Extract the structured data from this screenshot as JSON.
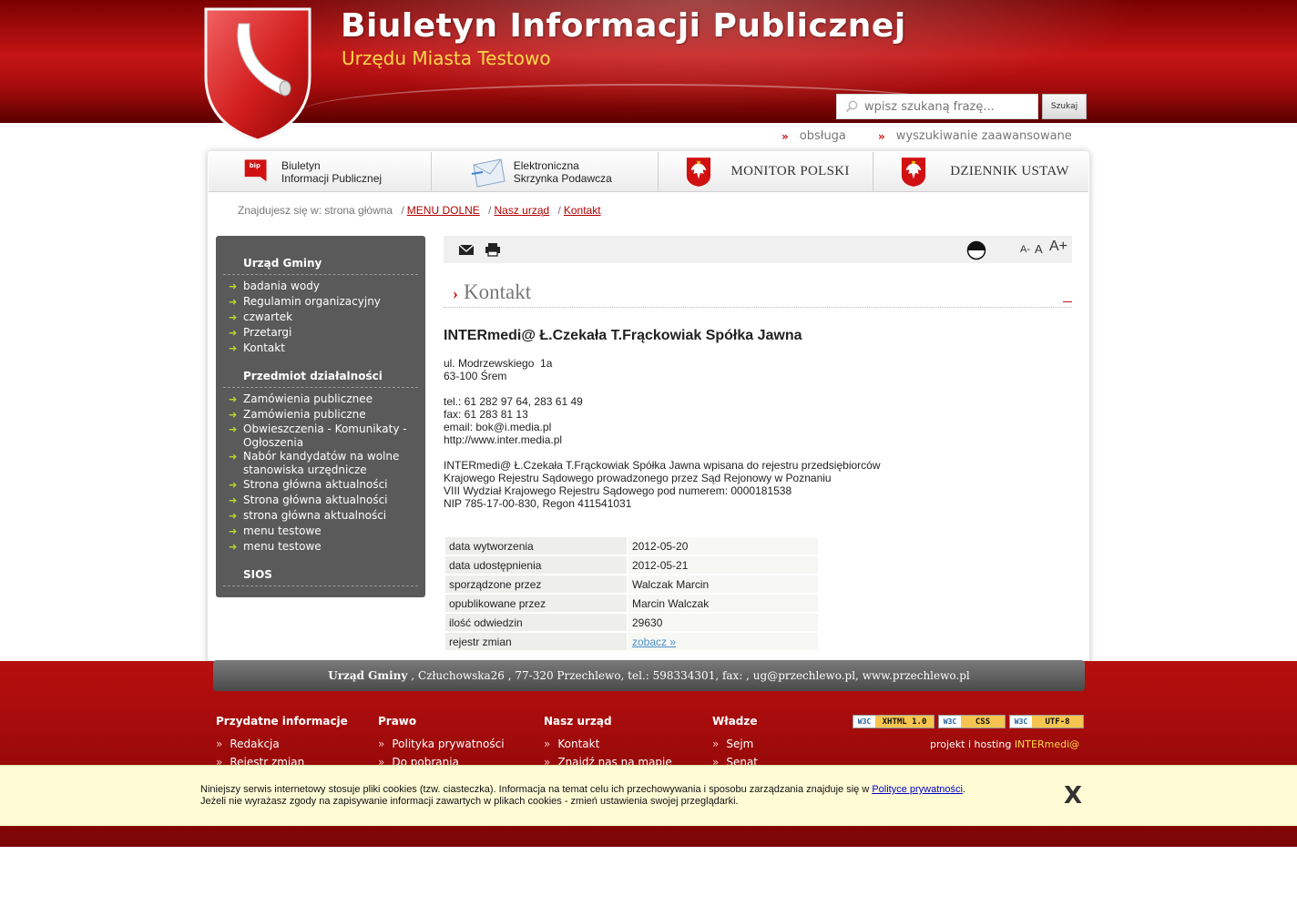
{
  "header": {
    "title": "Biuletyn Informacji Publicznej",
    "subtitle": "Urzędu Miasta Testowo",
    "search_placeholder": "wpisz szukaną frazę...",
    "search_button": "Szukaj"
  },
  "toplinks": {
    "service": "obsługa",
    "advanced_search": "wyszukiwanie zaawansowane"
  },
  "banners": {
    "bip": "Biuletyn\nInformacji Publicznej",
    "bip_logo": "bip",
    "epuap": "Elektroniczna\nSkrzynka Podawcza",
    "monitor": "MONITOR POLSKI",
    "dziennik": "DZIENNIK USTAW"
  },
  "breadcrumb": {
    "prefix": "Znajdujesz się w: strona główna",
    "items": [
      "MENU DOLNE",
      "Nasz urząd",
      "Kontakt"
    ]
  },
  "sidebar": {
    "sections": [
      {
        "title": "Urząd Gminy",
        "items": [
          "badania wody",
          "Regulamin organizacyjny",
          "czwartek",
          "Przetargi",
          "Kontakt"
        ]
      },
      {
        "title": "Przedmiot działalności",
        "items": [
          "Zamówienia publicznee",
          "Zamówienia publiczne",
          "Obwieszczenia - Komunikaty - Ogłoszenia",
          "Nabór kandydatów na wolne stanowiska urzędnicze",
          "Strona główna aktualności",
          "Strona główna aktualności",
          "strona główna aktualności",
          "menu testowe",
          "menu testowe"
        ]
      },
      {
        "title": "SIOS",
        "items": []
      }
    ]
  },
  "content": {
    "section_title": "Kontakt",
    "company": "INTERmedi@ Ł.Czekała T.Frąckowiak Spółka Jawna",
    "address": "ul. Modrzewskiego  1a\n63-100 Śrem",
    "contact": "tel.: 61 282 97 64, 283 61 49\nfax: 61 283 81 13\nemail: bok@i.media.pl\nhttp://www.inter.media.pl",
    "registry": "INTERmedi@ Ł.Czekała T.Frąckowiak Spółka Jawna wpisana do rejestru przedsiębiorców\nKrajowego Rejestru Sądowego prowadzonego przez Sąd Rejonowy w Poznaniu\nVIII Wydział Krajowego Rejestru Sądowego pod numerem: 0000181538\nNIP 785-17-00-830, Regon 411541031",
    "font_sizes": [
      "A-",
      "A",
      "A+"
    ],
    "meta": [
      {
        "label": "data wytworzenia",
        "value": "2012-05-20"
      },
      {
        "label": "data udostępnienia",
        "value": "2012-05-21"
      },
      {
        "label": "sporządzone przez",
        "value": "Walczak Marcin"
      },
      {
        "label": "opublikowane przez",
        "value": "Marcin Walczak"
      },
      {
        "label": "ilość odwiedzin",
        "value": "29630"
      },
      {
        "label": "rejestr zmian",
        "value": "zobacz »"
      }
    ]
  },
  "footer": {
    "office": "Urząd Gminy",
    "address": ", Człuchowska26 , 77-320 Przechlewo,  tel.:  598334301,  fax:  , ug@przechlewo.pl, www.przechlewo.pl",
    "columns": [
      {
        "title": "Przydatne informacje",
        "items": [
          "Redakcja",
          "Rejestr zmian"
        ]
      },
      {
        "title": "Prawo",
        "items": [
          "Polityka prywatności",
          "Do pobrania"
        ]
      },
      {
        "title": "Nasz urząd",
        "items": [
          "Kontakt",
          "Znajdź nas na mapie"
        ]
      },
      {
        "title": "Władze",
        "items": [
          "Sejm",
          "Senat"
        ]
      }
    ],
    "badges": [
      "XHTML 1.0",
      "CSS",
      "UTF-8"
    ],
    "badge_prefix": "W3C",
    "credits_prefix": "projekt i hosting",
    "credits_brand": "INTERmedi@"
  },
  "cookie": {
    "line1": "Niniejszy serwis internetowy stosuje pliki cookies (tzw. ciasteczka). Informacja na temat celu ich przechowywania i sposobu zarządzania znajduje się w ",
    "link": "Polityce prywatności",
    "line1_end": ".",
    "line2": "Jeżeli nie wyrażasz zgody na zapisywanie informacji zawartych w plikach cookies - zmień ustawienia swojej przeglądarki.",
    "close": "X"
  },
  "colors": {
    "brand_red": "#b70f0f",
    "subtitle_yellow": "#ffd84a",
    "sidebar_gray": "#5a5a5a",
    "bullet_green": "#b5d92b"
  }
}
